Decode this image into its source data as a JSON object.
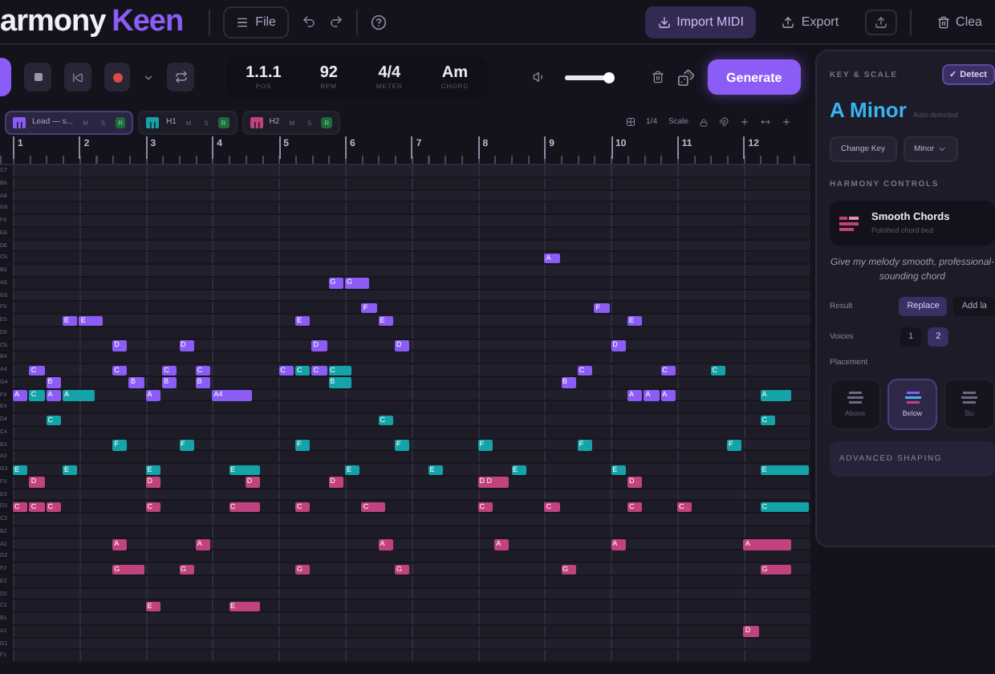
{
  "app": {
    "logo_main": "armony",
    "logo_accent": "Keen"
  },
  "toolbar": {
    "file": "File",
    "import": "Import MIDI",
    "export": "Export",
    "clear": "Clea"
  },
  "transport": {
    "record_armed": true,
    "display": [
      {
        "value": "1.1.1",
        "label": "POS"
      },
      {
        "value": "92",
        "label": "BPM"
      },
      {
        "value": "4/4",
        "label": "METER"
      },
      {
        "value": "Am",
        "label": "CHORD"
      }
    ],
    "volume": {
      "level": 0.95
    },
    "generate": "Generate"
  },
  "tracks": [
    {
      "name": "Lead — s...",
      "color": "#8b5cf6",
      "selected": true,
      "mute": "M",
      "solo": "S",
      "arm": "R",
      "armed": true
    },
    {
      "name": "H1",
      "color": "#14a3a8",
      "selected": false,
      "mute": "M",
      "solo": "S",
      "arm": "R",
      "armed": true
    },
    {
      "name": "H2",
      "color": "#c0427e",
      "selected": false,
      "mute": "M",
      "solo": "S",
      "arm": "R",
      "armed": true
    }
  ],
  "grid_tools": {
    "snap": "1/4",
    "scale": "Scale"
  },
  "ruler": [
    "1",
    "2",
    "3",
    "4",
    "5",
    "6",
    "7",
    "8",
    "9",
    "10",
    "11",
    "12"
  ],
  "roll": [
    {
      "label": "C7"
    },
    {
      "label": "B6"
    },
    {
      "label": "A6"
    },
    {
      "label": "G6"
    },
    {
      "label": "F6"
    },
    {
      "label": "E6"
    },
    {
      "label": "D6"
    },
    {
      "label": "C6",
      "notes": [
        {
          "label": "A",
          "kind": "lead"
        }
      ]
    },
    {
      "label": "B5"
    },
    {
      "label": "A5",
      "notes": [
        {
          "label": "G",
          "kind": "lead"
        },
        {
          "label": "G",
          "kind": "lead"
        }
      ]
    },
    {
      "label": "G5"
    },
    {
      "label": "F5",
      "notes": [
        {
          "label": "F",
          "kind": "lead"
        },
        {
          "label": "F",
          "kind": "lead"
        }
      ]
    },
    {
      "label": "E5",
      "notes": [
        {
          "label": "E",
          "kind": "lead"
        },
        {
          "label": "E",
          "kind": "lead"
        },
        {
          "label": "E",
          "kind": "lead"
        },
        {
          "label": "E",
          "kind": "lead"
        },
        {
          "label": "E",
          "kind": "lead"
        }
      ]
    },
    {
      "label": "D5"
    },
    {
      "label": "C5",
      "notes": [
        {
          "label": "D",
          "kind": "lead"
        },
        {
          "label": "D",
          "kind": "lead"
        },
        {
          "label": "D",
          "kind": "lead"
        },
        {
          "label": "D",
          "kind": "lead"
        },
        {
          "label": "D",
          "kind": "lead"
        }
      ]
    },
    {
      "label": "B4"
    },
    {
      "label": "A4",
      "notes": [
        {
          "label": "C",
          "kind": "lead"
        },
        {
          "label": "C",
          "kind": "lead"
        },
        {
          "label": "C",
          "kind": "lead"
        },
        {
          "label": "C",
          "kind": "lead"
        },
        {
          "label": "C",
          "kind": "lead"
        },
        {
          "label": "C",
          "kind": "harmony1"
        },
        {
          "label": "C",
          "kind": "lead"
        },
        {
          "label": "C",
          "kind": "harmony1"
        },
        {
          "label": "C",
          "kind": "lead"
        },
        {
          "label": "C",
          "kind": "lead"
        },
        {
          "label": "C",
          "kind": "harmony1"
        }
      ]
    },
    {
      "label": "G4",
      "notes": [
        {
          "label": "B",
          "kind": "lead"
        },
        {
          "label": "B",
          "kind": "lead"
        },
        {
          "label": "B",
          "kind": "lead"
        },
        {
          "label": "B",
          "kind": "lead"
        },
        {
          "label": "B",
          "kind": "harmony1"
        },
        {
          "label": "B",
          "kind": "lead"
        }
      ]
    },
    {
      "label": "F4",
      "notes": [
        {
          "label": "A",
          "kind": "lead"
        },
        {
          "label": "C",
          "kind": "harmony1"
        },
        {
          "label": "A",
          "kind": "lead"
        },
        {
          "label": "A",
          "kind": "harmony1"
        },
        {
          "label": "A",
          "kind": "lead"
        },
        {
          "label": "A4",
          "kind": "lead"
        },
        {
          "label": "A",
          "kind": "lead"
        },
        {
          "label": "A",
          "kind": "lead"
        },
        {
          "label": "A",
          "kind": "lead"
        },
        {
          "label": "A",
          "kind": "harmony1"
        }
      ]
    },
    {
      "label": "E4"
    },
    {
      "label": "D4",
      "notes": [
        {
          "label": "C",
          "kind": "harmony1"
        },
        {
          "label": "C",
          "kind": "harmony1"
        },
        {
          "label": "C",
          "kind": "harmony1"
        }
      ]
    },
    {
      "label": "C4"
    },
    {
      "label": "B3",
      "notes": [
        {
          "label": "F",
          "kind": "harmony1"
        },
        {
          "label": "F",
          "kind": "harmony1"
        },
        {
          "label": "F",
          "kind": "harmony1"
        },
        {
          "label": "F",
          "kind": "harmony1"
        },
        {
          "label": "F",
          "kind": "harmony1"
        },
        {
          "label": "F",
          "kind": "harmony1"
        },
        {
          "label": "F",
          "kind": "harmony1"
        }
      ]
    },
    {
      "label": "A3"
    },
    {
      "label": "G3",
      "notes": [
        {
          "label": "E",
          "kind": "harmony1"
        },
        {
          "label": "E",
          "kind": "harmony1"
        },
        {
          "label": "E",
          "kind": "harmony1"
        },
        {
          "label": "E",
          "kind": "harmony1"
        },
        {
          "label": "E",
          "kind": "harmony1"
        },
        {
          "label": "E",
          "kind": "harmony1"
        },
        {
          "label": "E",
          "kind": "harmony1"
        },
        {
          "label": "E",
          "kind": "harmony1"
        },
        {
          "label": "E",
          "kind": "harmony1"
        }
      ]
    },
    {
      "label": "F3",
      "notes": [
        {
          "label": "D",
          "kind": "harmony2"
        },
        {
          "label": "D",
          "kind": "harmony2"
        },
        {
          "label": "D",
          "kind": "harmony2"
        },
        {
          "label": "D",
          "kind": "harmony2"
        },
        {
          "label": "D D",
          "kind": "harmony2"
        },
        {
          "label": "D",
          "kind": "harmony2"
        }
      ]
    },
    {
      "label": "E3"
    },
    {
      "label": "D3",
      "notes": [
        {
          "label": "C",
          "kind": "harmony2"
        },
        {
          "label": "C",
          "kind": "harmony2"
        },
        {
          "label": "C",
          "kind": "harmony2"
        },
        {
          "label": "C",
          "kind": "harmony2"
        },
        {
          "label": "C",
          "kind": "harmony2"
        },
        {
          "label": "C",
          "kind": "harmony2"
        },
        {
          "label": "C",
          "kind": "harmony2"
        },
        {
          "label": "C",
          "kind": "harmony2"
        },
        {
          "label": "C",
          "kind": "harmony2"
        },
        {
          "label": "C",
          "kind": "harmony2"
        },
        {
          "label": "C",
          "kind": "harmony2"
        },
        {
          "label": "C",
          "kind": "harmony1"
        }
      ]
    },
    {
      "label": "C3"
    },
    {
      "label": "B2"
    },
    {
      "label": "A2",
      "notes": [
        {
          "label": "A",
          "kind": "harmony2"
        },
        {
          "label": "A",
          "kind": "harmony2"
        },
        {
          "label": "A",
          "kind": "harmony2"
        },
        {
          "label": "A",
          "kind": "harmony2"
        },
        {
          "label": "A",
          "kind": "harmony2"
        },
        {
          "label": "A",
          "kind": "harmony2"
        }
      ]
    },
    {
      "label": "G2"
    },
    {
      "label": "F2",
      "notes": [
        {
          "label": "G",
          "kind": "harmony2"
        },
        {
          "label": "G",
          "kind": "harmony2"
        },
        {
          "label": "G",
          "kind": "harmony2"
        },
        {
          "label": "G",
          "kind": "harmony2"
        },
        {
          "label": "G",
          "kind": "harmony2"
        },
        {
          "label": "G",
          "kind": "harmony2"
        }
      ]
    },
    {
      "label": "E2"
    },
    {
      "label": "D2"
    },
    {
      "label": "C2",
      "notes": [
        {
          "label": "E",
          "kind": "harmony2"
        },
        {
          "label": "E",
          "kind": "harmony2"
        }
      ]
    },
    {
      "label": "B1"
    },
    {
      "label": "A1",
      "notes": [
        {
          "label": "D",
          "kind": "harmony2"
        }
      ]
    },
    {
      "label": "G1"
    },
    {
      "label": "F1"
    }
  ],
  "panel": {
    "key_heading": "KEY & SCALE",
    "detect": "✓ Detect",
    "key": "A Minor",
    "key_note": "Auto-detected",
    "change_key": "Change Key",
    "mode": "Minor",
    "harmony_heading": "HARMONY CONTROLS",
    "preset": {
      "title": "Smooth Chords",
      "subtitle": "Polished chord bed"
    },
    "prompt": "Give my melody smooth, professional-sounding chord",
    "result": {
      "label": "Result",
      "options": [
        {
          "label": "Replace",
          "selected": true
        },
        {
          "label": "Add la",
          "selected": false
        }
      ]
    },
    "voices": {
      "label": "Voices",
      "options": [
        {
          "label": "1",
          "selected": false
        },
        {
          "label": "2",
          "selected": true
        }
      ]
    },
    "placement": {
      "label": "Placement",
      "options": [
        {
          "label": "Above",
          "selected": false
        },
        {
          "label": "Below",
          "selected": true
        },
        {
          "label": "Bo",
          "selected": false
        }
      ]
    },
    "advanced": "ADVANCED SHAPING"
  }
}
